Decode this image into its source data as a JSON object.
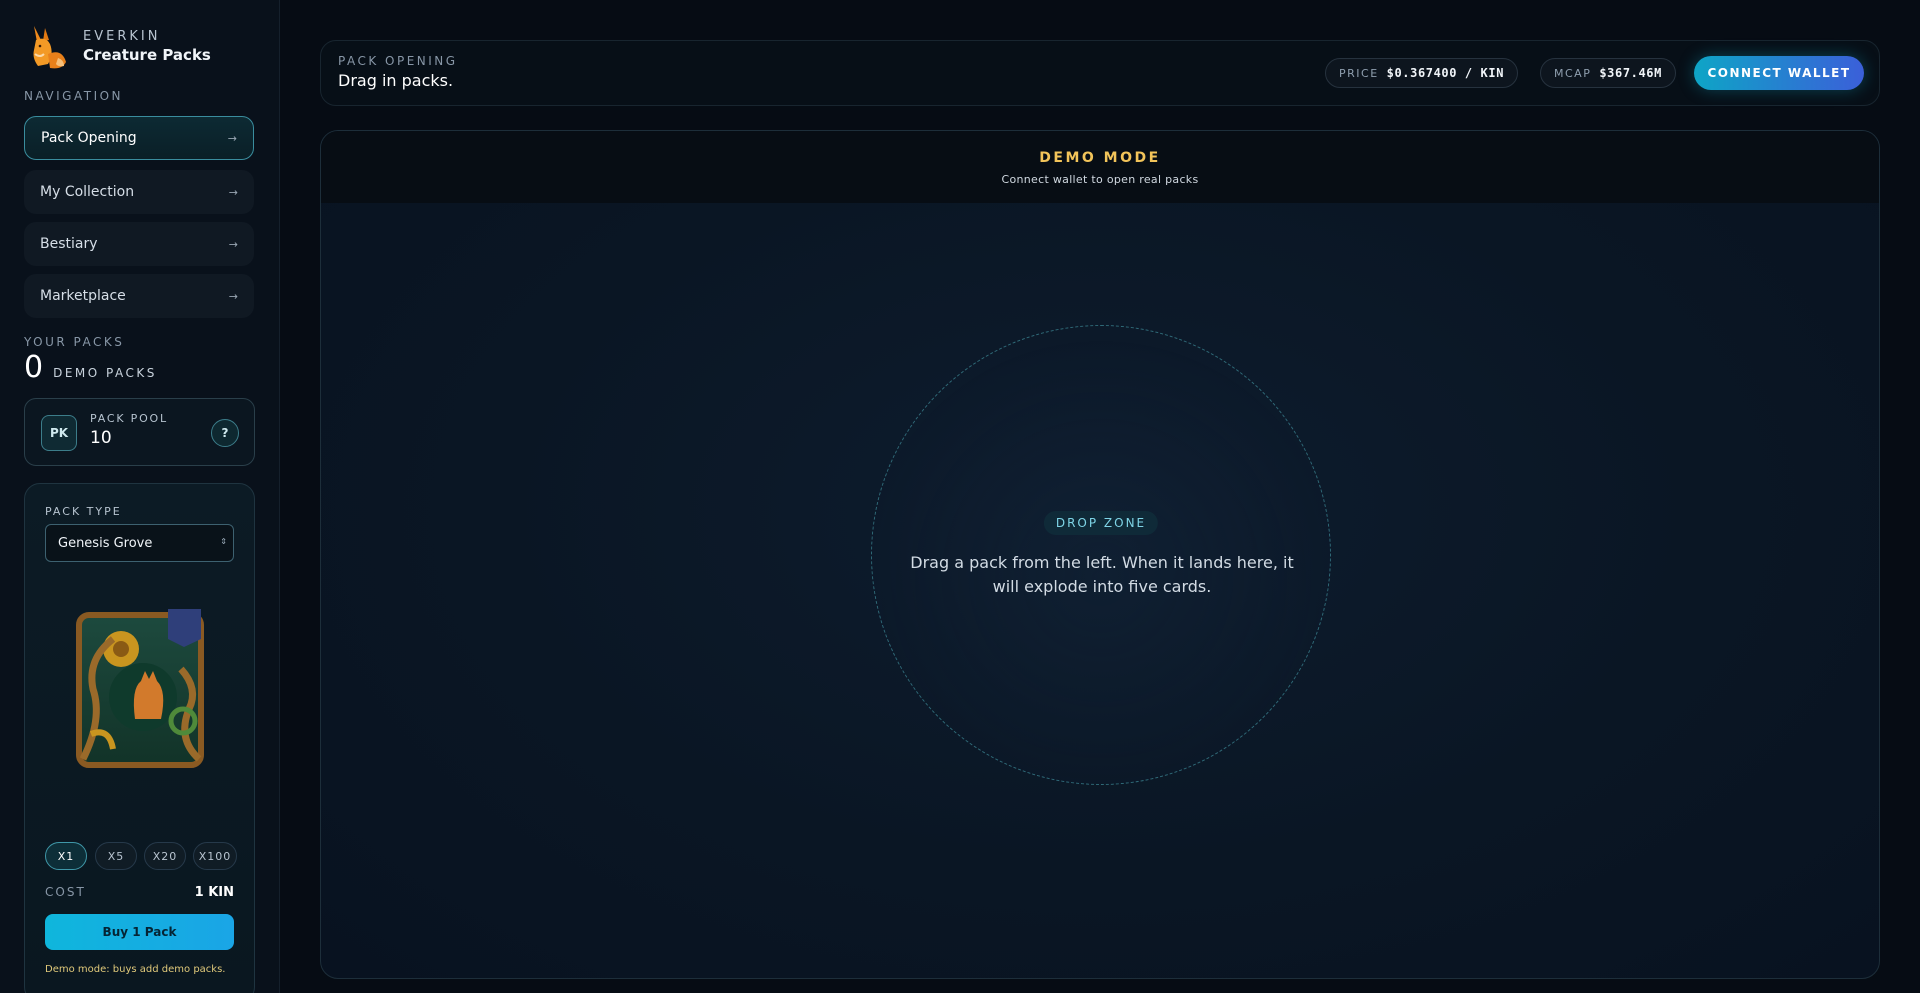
{
  "brand": {
    "small": "EVERKIN",
    "big": "Creature Packs"
  },
  "nav": {
    "label": "NAVIGATION",
    "items": [
      {
        "label": "Pack Opening",
        "arrow": "→",
        "active": true
      },
      {
        "label": "My Collection",
        "arrow": "→",
        "active": false
      },
      {
        "label": "Bestiary",
        "arrow": "→",
        "active": false
      },
      {
        "label": "Marketplace",
        "arrow": "→",
        "active": false
      }
    ]
  },
  "packs": {
    "label": "YOUR PACKS",
    "count": "0",
    "unit": "DEMO PACKS"
  },
  "pool": {
    "badge": "PK",
    "label": "PACK POOL",
    "value": "10",
    "help": "?"
  },
  "shop": {
    "type_label": "PACK TYPE",
    "selected_type": "Genesis Grove",
    "quantities": [
      {
        "label": "X1",
        "active": true
      },
      {
        "label": "X5",
        "active": false
      },
      {
        "label": "X20",
        "active": false
      },
      {
        "label": "X100",
        "active": false
      }
    ],
    "cost_label": "COST",
    "cost_value": "1 KIN",
    "buy_label": "Buy 1 Pack",
    "demo_note": "Demo mode: buys add demo packs."
  },
  "header": {
    "label": "PACK OPENING",
    "title": "Drag in packs.",
    "price_label": "PRICE",
    "price_value": "$0.367400 / KIN",
    "mcap_label": "MCAP",
    "mcap_value": "$367.46M",
    "connect_label": "CONNECT WALLET"
  },
  "stage": {
    "demo_title": "DEMO MODE",
    "demo_sub": "Connect wallet to open real packs",
    "drop_badge": "DROP ZONE",
    "drop_text": "Drag a pack from the left. When it lands here, it will explode into five cards."
  },
  "colors": {
    "accent_teal": "#3a8d9e",
    "demo_gold": "#f2c45a",
    "buy_cyan": "#0fb6dc",
    "wallet_gradient_end": "#3b5fd9"
  },
  "icons": {
    "logo": "fox-logo-icon",
    "select": "select-arrows-icon",
    "pack": "genesis-grove-pack-icon"
  }
}
